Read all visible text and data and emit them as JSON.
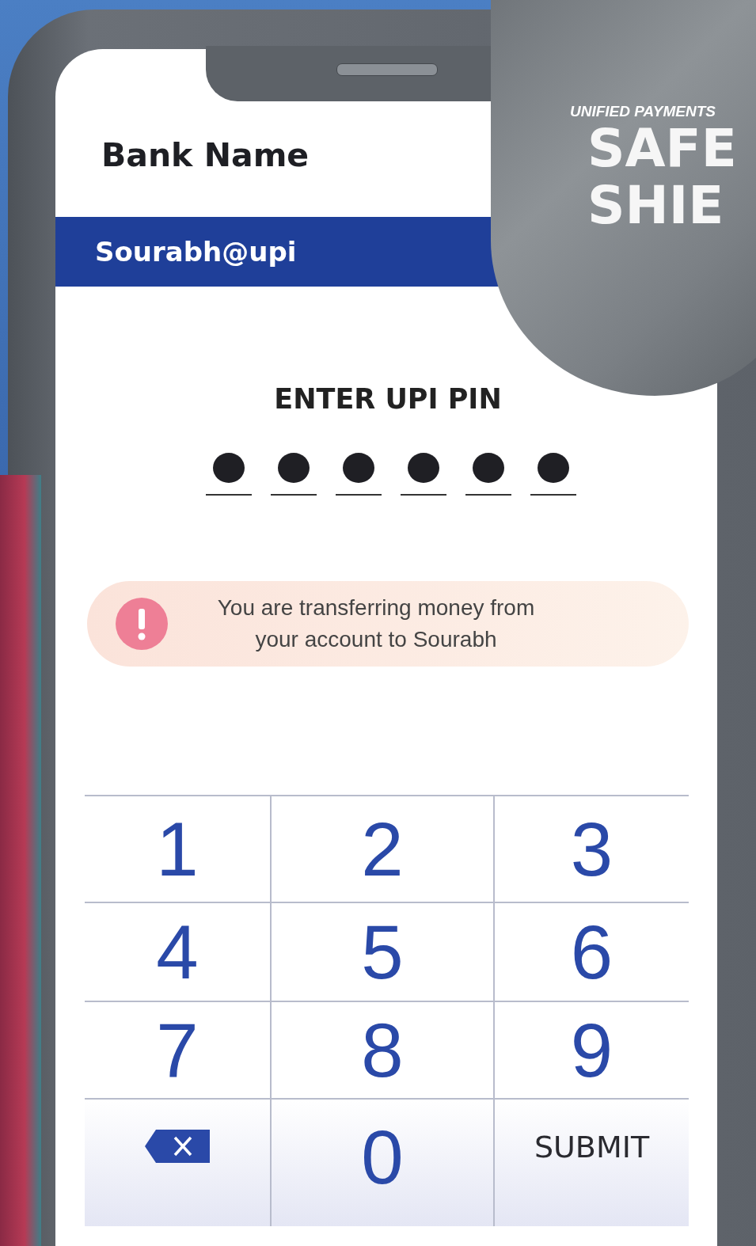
{
  "header": {
    "bank_name": "Bank Name"
  },
  "vpa_bar": {
    "vpa": "Sourabh@upi"
  },
  "pin": {
    "title": "ENTER UPI PIN",
    "digits": [
      {
        "filled": true
      },
      {
        "filled": true
      },
      {
        "filled": true
      },
      {
        "filled": true
      },
      {
        "filled": true
      },
      {
        "filled": true
      }
    ]
  },
  "alert": {
    "message": "You are transferring money from your account to Sourabh"
  },
  "keypad": {
    "keys": [
      {
        "kind": "digit",
        "label": "1"
      },
      {
        "kind": "digit",
        "label": "2"
      },
      {
        "kind": "digit",
        "label": "3"
      },
      {
        "kind": "digit",
        "label": "4"
      },
      {
        "kind": "digit",
        "label": "5"
      },
      {
        "kind": "digit",
        "label": "6"
      },
      {
        "kind": "digit",
        "label": "7"
      },
      {
        "kind": "digit",
        "label": "8"
      },
      {
        "kind": "digit",
        "label": "9"
      },
      {
        "kind": "backspace"
      },
      {
        "kind": "digit",
        "label": "0"
      },
      {
        "kind": "submit",
        "label": "SUBMIT"
      }
    ]
  },
  "badge": {
    "tagline": "UNIFIED PAYMENTS",
    "title_lines": [
      "SAFE",
      "SHIE"
    ]
  }
}
